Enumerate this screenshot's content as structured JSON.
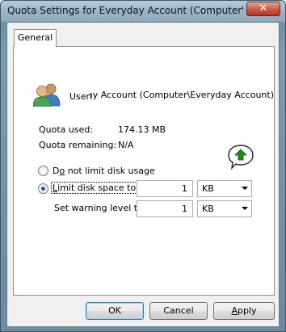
{
  "window": {
    "title": "Quota Settings for Everyday Account (Computer\\Ever...",
    "close_symbol": "✕"
  },
  "tabs": [
    {
      "label": "General"
    }
  ],
  "user": {
    "label": "User:",
    "value": "Everyday Account (Computer\\Everyday Account)",
    "icon": "users-icon"
  },
  "quota": {
    "used_label": "Quota used:",
    "used_value": "174.13 MB",
    "remaining_label": "Quota remaining:",
    "remaining_value": "N/A",
    "status_icon": "green-up-arrow-icon"
  },
  "options": {
    "no_limit": {
      "before": "D",
      "mnemonic": "o",
      "after": " not limit disk usage",
      "checked": false
    },
    "limit": {
      "before": "",
      "mnemonic": "L",
      "after": "imit disk space to",
      "checked": true
    },
    "limit_value": "1",
    "limit_unit": "KB",
    "warning_label": "Set warning level to",
    "warning_value": "1",
    "warning_unit": "KB"
  },
  "buttons": {
    "ok": "OK",
    "cancel": "Cancel",
    "apply_mnemonic": "A",
    "apply_rest": "pply"
  },
  "colors": {
    "accent_green": "#1c8a1c",
    "selection_blue": "#2a5b8b"
  }
}
